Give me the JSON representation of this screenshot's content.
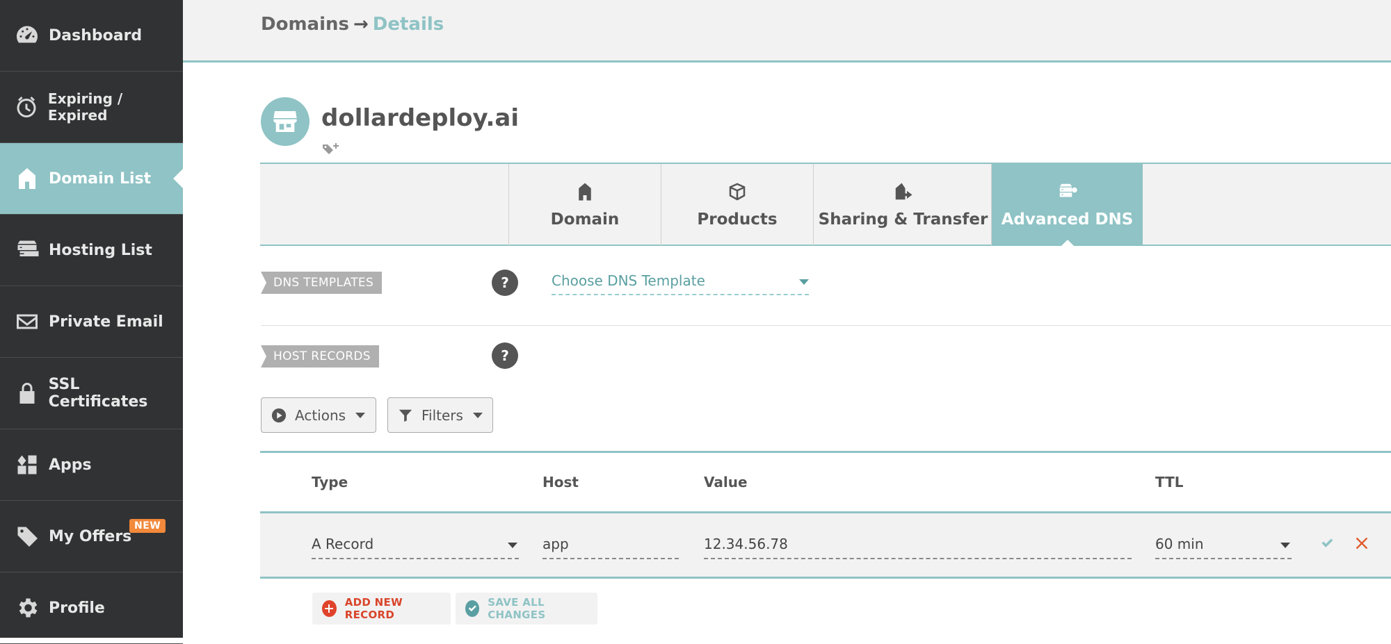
{
  "sidebar": {
    "items": [
      {
        "label": "Dashboard",
        "icon": "dashboard-gauge-icon"
      },
      {
        "label": "Expiring / Expired",
        "icon": "clock-icon"
      },
      {
        "label": "Domain List",
        "icon": "home-icon",
        "active": true
      },
      {
        "label": "Hosting List",
        "icon": "server-icon"
      },
      {
        "label": "Private Email",
        "icon": "envelope-icon"
      },
      {
        "label": "SSL Certificates",
        "icon": "lock-icon"
      },
      {
        "label": "Apps",
        "icon": "apps-grid-icon"
      },
      {
        "label": "My Offers",
        "icon": "tag-icon",
        "badge": "NEW"
      },
      {
        "label": "Profile",
        "icon": "gear-icon"
      }
    ]
  },
  "breadcrumb": {
    "parent": "Domains",
    "separator": "→",
    "current": "Details"
  },
  "domain": {
    "name": "dollardeploy.ai"
  },
  "tabs": [
    {
      "label": "Domain",
      "icon": "home-icon"
    },
    {
      "label": "Products",
      "icon": "box-icon"
    },
    {
      "label": "Sharing & Transfer",
      "icon": "share-transfer-icon"
    },
    {
      "label": "Advanced DNS",
      "icon": "dns-server-icon",
      "active": true
    }
  ],
  "dns_templates": {
    "label": "DNS TEMPLATES",
    "help": "?",
    "select_value": "Choose DNS Template"
  },
  "host_records": {
    "label": "HOST RECORDS",
    "help": "?"
  },
  "toolbar": {
    "actions_label": "Actions",
    "filters_label": "Filters"
  },
  "table": {
    "headers": {
      "type": "Type",
      "host": "Host",
      "value": "Value",
      "ttl": "TTL"
    },
    "rows": [
      {
        "type": "A Record",
        "host": "app",
        "value": "12.34.56.78",
        "ttl": "60 min"
      }
    ]
  },
  "footer": {
    "add_label": "ADD NEW RECORD",
    "save_label": "SAVE ALL CHANGES"
  },
  "colors": {
    "accent": "#8fc3c5",
    "sidebar_bg": "#313233",
    "danger": "#e05a2b",
    "badge": "#f2893b"
  }
}
